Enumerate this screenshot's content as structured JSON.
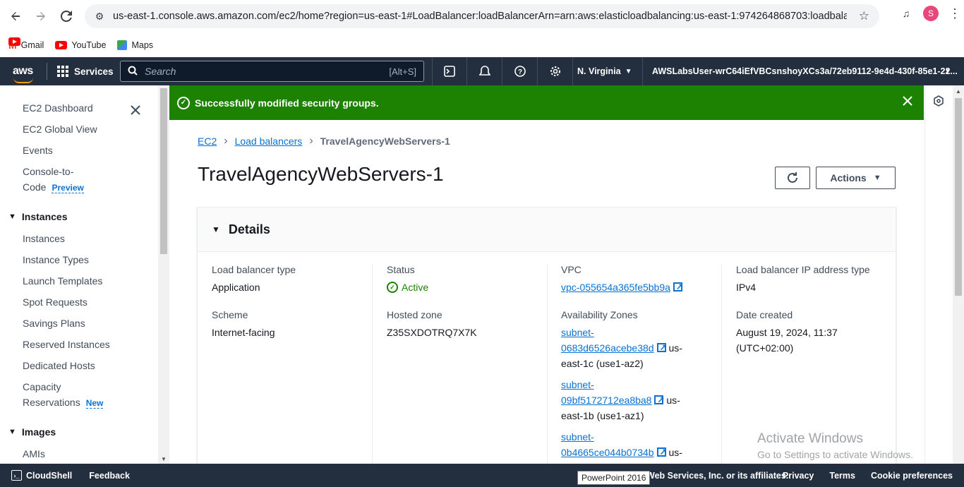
{
  "browser": {
    "url": "us-east-1.console.aws.amazon.com/ec2/home?region=us-east-1#LoadBalancer:loadBalancerArn=arn:aws:elasticloadbalancing:us-east-1:974264868703:loadbalancer/ap...",
    "profile_initial": "S",
    "bookmarks": [
      {
        "label": "Gmail"
      },
      {
        "label": "YouTube"
      },
      {
        "label": "Maps"
      }
    ]
  },
  "aws_nav": {
    "logo": "aws",
    "services": "Services",
    "search_placeholder": "Search",
    "search_hint": "[Alt+S]",
    "region": "N. Virginia",
    "account": "AWSLabsUser-wrC64iEfVBCsnshoyXCs3a/72eb9112-9e4d-430f-85e1-22..."
  },
  "sidebar": {
    "items_top": [
      {
        "label": "EC2 Dashboard"
      },
      {
        "label": "EC2 Global View"
      },
      {
        "label": "Events"
      }
    ],
    "console_to_code": {
      "line1": "Console-to-",
      "line2": "Code",
      "badge": "Preview"
    },
    "instances_section": "Instances",
    "instances_items": [
      {
        "label": "Instances"
      },
      {
        "label": "Instance Types"
      },
      {
        "label": "Launch Templates"
      },
      {
        "label": "Spot Requests"
      },
      {
        "label": "Savings Plans"
      },
      {
        "label": "Reserved Instances"
      },
      {
        "label": "Dedicated Hosts"
      }
    ],
    "capacity": {
      "line1": "Capacity",
      "line2": "Reservations",
      "badge": "New"
    },
    "images_section": "Images",
    "images_items": [
      {
        "label": "AMIs"
      }
    ]
  },
  "flash": {
    "message": "Successfully modified security groups."
  },
  "breadcrumb": {
    "ec2": "EC2",
    "load_balancers": "Load balancers",
    "current": "TravelAgencyWebServers-1"
  },
  "page": {
    "title": "TravelAgencyWebServers-1",
    "actions_label": "Actions"
  },
  "details": {
    "heading": "Details",
    "lb_type_key": "Load balancer type",
    "lb_type_val": "Application",
    "scheme_key": "Scheme",
    "scheme_val": "Internet-facing",
    "status_key": "Status",
    "status_val": "Active",
    "hosted_zone_key": "Hosted zone",
    "hosted_zone_val": "Z35SXDOTRQ7X7K",
    "vpc_key": "VPC",
    "vpc_val": "vpc-055654a365fe5bb9a",
    "az_key": "Availability Zones",
    "subnets": [
      {
        "prefix": "subnet-",
        "id": "0683d6526acebe38d",
        "suffix1": "us-",
        "suffix2": "east-1c (use1-az2)"
      },
      {
        "prefix": "subnet-",
        "id": "09bf5172712ea8ba8",
        "suffix1": "us-",
        "suffix2": "east-1b (use1-az1)"
      },
      {
        "prefix": "subnet-",
        "id": "0b4665ce044b0734b",
        "suffix1": "us-",
        "suffix2": ""
      }
    ],
    "ip_type_key": "Load balancer IP address type",
    "ip_type_val": "IPv4",
    "date_key": "Date created",
    "date_val1": "August 19, 2024, 11:37",
    "date_val2": "(UTC+02:00)"
  },
  "watermark": {
    "line1": "Activate Windows",
    "line2": "Go to Settings to activate Windows."
  },
  "footer": {
    "cloudshell": "CloudShell",
    "feedback": "Feedback",
    "copyright": "Web Services, Inc. or its affiliates.",
    "privacy": "Privacy",
    "terms": "Terms",
    "cookies": "Cookie preferences",
    "tooltip": "PowerPoint 2016"
  },
  "colors": {
    "aws_nav_bg": "#232f3e",
    "flash_success": "#1d8102",
    "link_blue": "#0972d3",
    "aws_orange": "#ff9900"
  }
}
